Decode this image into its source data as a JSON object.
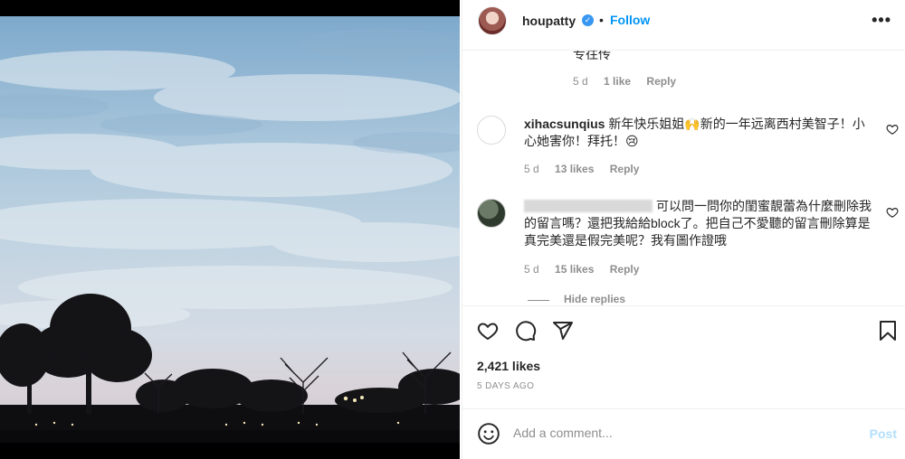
{
  "post": {
    "username": "houpatty",
    "follow_label": "Follow",
    "dot": "•",
    "more_label": "•••"
  },
  "comments": {
    "truncated_text": "专往传",
    "truncated_meta": {
      "age": "5 d",
      "likes": "1 like",
      "reply": "Reply"
    },
    "items": [
      {
        "username": "xihacsunqius",
        "text": " 新年快乐姐姐🙌新的一年远离西村美智子！小心她害你！拜托！😢",
        "age": "5 d",
        "likes": "13 likes",
        "reply": "Reply"
      },
      {
        "username": "",
        "text": "可以問一問你的閨蜜靚蕾為什麼刪除我的留言嗎？還把我給給block了。把自己不愛聽的留言刪除算是真完美還是假完美呢？我有圖作證哦",
        "age": "5 d",
        "likes": "15 likes",
        "reply": "Reply"
      }
    ],
    "hide_replies": "Hide replies"
  },
  "actions": {
    "like_icon": "heart-icon",
    "comment_icon": "comment-icon",
    "share_icon": "send-icon",
    "save_icon": "bookmark-icon"
  },
  "stats": {
    "likes": "2,421 likes",
    "time": "5 DAYS AGO"
  },
  "composer": {
    "placeholder": "Add a comment...",
    "post_label": "Post"
  },
  "colors": {
    "accent": "#0095f6",
    "post_disabled": "#b2dffc",
    "meta_gray": "#8e8e8e"
  }
}
